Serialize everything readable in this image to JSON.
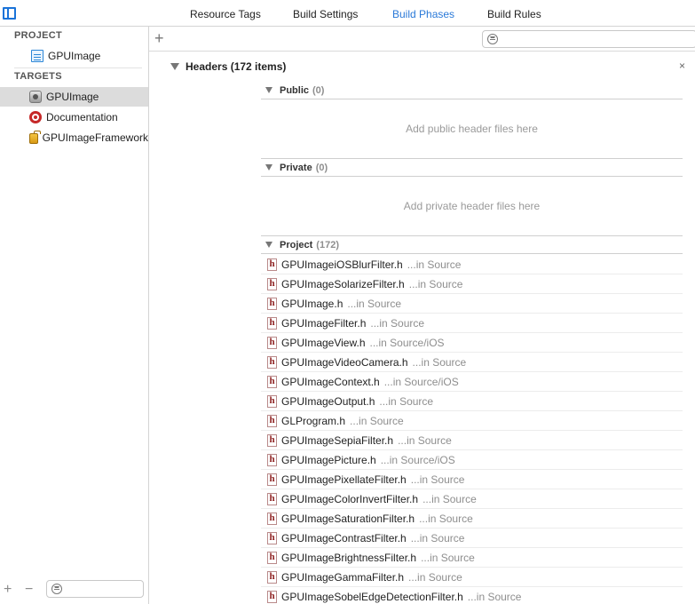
{
  "tabs": [
    {
      "label": "Resource Tags",
      "active": false
    },
    {
      "label": "Build Settings",
      "active": false
    },
    {
      "label": "Build Phases",
      "active": true
    },
    {
      "label": "Build Rules",
      "active": false
    }
  ],
  "sidebar": {
    "project_header": "PROJECT",
    "project_item": "GPUImage",
    "targets_header": "TARGETS",
    "targets": [
      {
        "label": "GPUImage",
        "icon": "app-target-icon",
        "selected": true
      },
      {
        "label": "Documentation",
        "icon": "bullseye-target-icon",
        "selected": false
      },
      {
        "label": "GPUImageFramework",
        "icon": "framework-toolbox-icon",
        "selected": false
      }
    ],
    "add_symbol": "+",
    "remove_symbol": "−"
  },
  "main": {
    "add_symbol": "+",
    "close_symbol": "×",
    "phase_title": "Headers (172 items)",
    "public": {
      "label": "Public",
      "count": "(0)",
      "placeholder": "Add public header files here"
    },
    "private": {
      "label": "Private",
      "count": "(0)",
      "placeholder": "Add private header files here"
    },
    "project": {
      "label": "Project",
      "count": "(172)"
    },
    "files": [
      {
        "name": "GPUImageiOSBlurFilter.h",
        "path": "...in Source"
      },
      {
        "name": "GPUImageSolarizeFilter.h",
        "path": "...in Source"
      },
      {
        "name": "GPUImage.h",
        "path": "...in Source"
      },
      {
        "name": "GPUImageFilter.h",
        "path": "...in Source"
      },
      {
        "name": "GPUImageView.h",
        "path": "...in Source/iOS"
      },
      {
        "name": "GPUImageVideoCamera.h",
        "path": "...in Source"
      },
      {
        "name": "GPUImageContext.h",
        "path": "...in Source/iOS"
      },
      {
        "name": "GPUImageOutput.h",
        "path": "...in Source"
      },
      {
        "name": "GLProgram.h",
        "path": "...in Source"
      },
      {
        "name": "GPUImageSepiaFilter.h",
        "path": "...in Source"
      },
      {
        "name": "GPUImagePicture.h",
        "path": "...in Source/iOS"
      },
      {
        "name": "GPUImagePixellateFilter.h",
        "path": "...in Source"
      },
      {
        "name": "GPUImageColorInvertFilter.h",
        "path": "...in Source"
      },
      {
        "name": "GPUImageSaturationFilter.h",
        "path": "...in Source"
      },
      {
        "name": "GPUImageContrastFilter.h",
        "path": "...in Source"
      },
      {
        "name": "GPUImageBrightnessFilter.h",
        "path": "...in Source"
      },
      {
        "name": "GPUImageGammaFilter.h",
        "path": "...in Source"
      },
      {
        "name": "GPUImageSobelEdgeDetectionFilter.h",
        "path": "...in Source"
      }
    ]
  },
  "colors": {
    "accent": "#2a79d8",
    "selection": "#dcdcdc",
    "header_icon": "#8c1e1e"
  }
}
